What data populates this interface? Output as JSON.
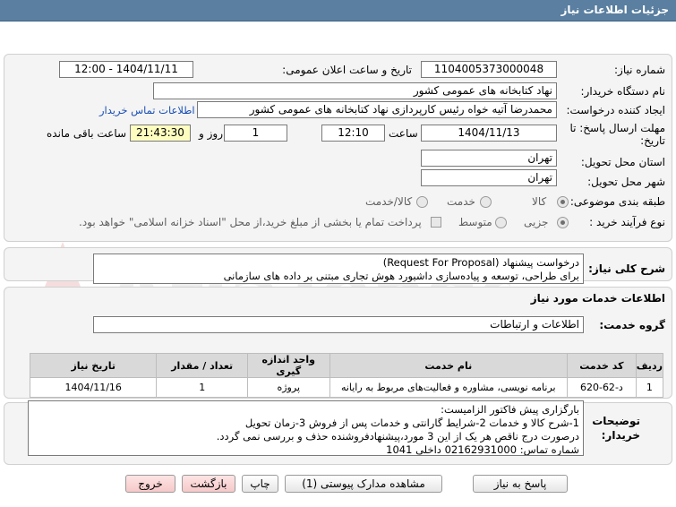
{
  "header": {
    "title": "جزئیات اطلاعات نیاز"
  },
  "fields": {
    "need_number_label": "شماره نیاز:",
    "need_number": "1104005373000048",
    "announce_label": "تاریخ و ساعت اعلان عمومی:",
    "announce_value": "1404/11/11 - 12:00",
    "buyer_org_label": "نام دستگاه خریدار:",
    "buyer_org": "نهاد کتابخانه های عمومی کشور",
    "creator_label": "ایجاد کننده درخواست:",
    "creator": "محمدرضا آتیه خواه  رئیس کارپردازی نهاد کتابخانه های عمومی کشور",
    "contact_link": "اطلاعات تماس خریدار",
    "deadline_label_1": "مهلت ارسال پاسخ: تا",
    "deadline_label_2": "تاریخ:",
    "deadline_date": "1404/11/13",
    "time_label": "ساعت",
    "deadline_time": "12:10",
    "days_value": "1",
    "days_label": "روز و",
    "remaining_time": "21:43:30",
    "remaining_label": "ساعت باقی مانده",
    "province_label": "استان محل تحویل:",
    "province": "تهران",
    "city_label": "شهر محل تحویل:",
    "city": "تهران",
    "category_label": "طبقه بندی موضوعی:",
    "category_options": [
      "کالا",
      "خدمت",
      "کالا/خدمت"
    ],
    "process_label": "نوع فرآیند خرید :",
    "process_options": [
      "جزیی",
      "متوسط"
    ],
    "payment_note": "پرداخت تمام یا بخشی از مبلغ خرید،از محل \"اسناد خزانه اسلامی\" خواهد بود."
  },
  "description": {
    "label": "شرح کلی نیاز:",
    "line1": "درخواست پیشنهاد (Request For Proposal)",
    "line2": "برای طراحی، توسعه و پیاده‌سازی داشبورد هوش تجاری مبتنی بر داده های سازمانی"
  },
  "services": {
    "section_title": "اطلاعات خدمات مورد نیاز",
    "group_label": "گروه خدمت:",
    "group_value": "اطلاعات و ارتباطات",
    "columns": [
      "ردیف",
      "کد خدمت",
      "نام خدمت",
      "واحد اندازه گیری",
      "تعداد / مقدار",
      "تاریخ نیاز"
    ],
    "rows": [
      {
        "row": "1",
        "code": "د-62-620",
        "name": "برنامه نویسی، مشاوره و فعالیت‌های مربوط به رایانه",
        "unit": "پروژه",
        "qty": "1",
        "date": "1404/11/16"
      }
    ]
  },
  "buyer_notes": {
    "label_1": "توضیحات",
    "label_2": "خریدار:",
    "lines": [
      "بارگزاری پیش فاکتور الزامیست:",
      "1-شرح کالا و خدمات 2-شرایط گارانتی و خدمات پس از فروش 3-زمان تحویل",
      "درصورت درج ناقص هر یک از این 3 مورد،پیشنهادفروشنده حذف و بررسی نمی گردد.",
      "شماره تماس: 02162931000 داخلی 1041"
    ]
  },
  "buttons": {
    "reply": "پاسخ به نیاز",
    "attachments": "مشاهده مدارک پیوستی (1)",
    "print": "چاپ",
    "back": "بازگشت",
    "exit": "خروج"
  },
  "watermark": {
    "text": "AriaTender.net"
  }
}
